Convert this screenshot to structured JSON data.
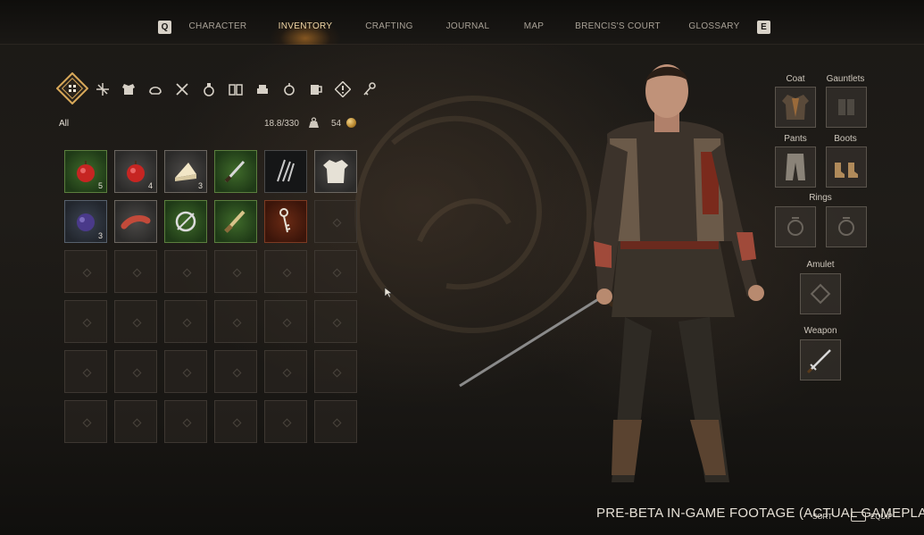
{
  "nav": {
    "left_key": "Q",
    "right_key": "E",
    "tabs": [
      {
        "label": "CHARACTER",
        "active": false
      },
      {
        "label": "INVENTORY",
        "active": true
      },
      {
        "label": "CRAFTING",
        "active": false
      },
      {
        "label": "JOURNAL",
        "active": false
      },
      {
        "label": "MAP",
        "active": false
      },
      {
        "label": "BRENCIS'S COURT",
        "active": false
      },
      {
        "label": "GLOSSARY",
        "active": false
      }
    ]
  },
  "categories": [
    {
      "icon": "all-items-icon",
      "selected": true
    },
    {
      "icon": "crossbow-icon"
    },
    {
      "icon": "armor-icon"
    },
    {
      "icon": "helmet-icon"
    },
    {
      "icon": "tools-icon"
    },
    {
      "icon": "potion-icon"
    },
    {
      "icon": "book-icon"
    },
    {
      "icon": "food-icon"
    },
    {
      "icon": "trinket-icon"
    },
    {
      "icon": "mug-icon"
    },
    {
      "icon": "quest-icon"
    },
    {
      "icon": "key-icon"
    }
  ],
  "filter_label": "All",
  "weight": "18.8/330",
  "gold": "54",
  "inventory": [
    {
      "item": "apple",
      "qty": "5",
      "rarity": "green"
    },
    {
      "item": "apple",
      "qty": "4",
      "rarity": "gray"
    },
    {
      "item": "cheese",
      "qty": "3",
      "rarity": "gray"
    },
    {
      "item": "dagger",
      "qty": "",
      "rarity": "green"
    },
    {
      "item": "lockpicks",
      "qty": "",
      "rarity": "dark"
    },
    {
      "item": "shirt",
      "qty": "",
      "rarity": "gray"
    },
    {
      "item": "plum",
      "qty": "3",
      "rarity": "blue"
    },
    {
      "item": "sausage",
      "qty": "",
      "rarity": "gray"
    },
    {
      "item": "ring",
      "qty": "",
      "rarity": "green"
    },
    {
      "item": "knife",
      "qty": "",
      "rarity": "green"
    },
    {
      "item": "key",
      "qty": "",
      "rarity": "red"
    }
  ],
  "equipment": {
    "coat": "Coat",
    "gauntlets": "Gauntlets",
    "pants": "Pants",
    "boots": "Boots",
    "rings": "Rings",
    "amulet": "Amulet",
    "weapon": "Weapon"
  },
  "footer": {
    "watermark": "PRE-BETA IN-GAME FOOTAGE (ACTUAL GAMEPLAY)",
    "sort": "SORT",
    "equip": "EQUIP"
  }
}
